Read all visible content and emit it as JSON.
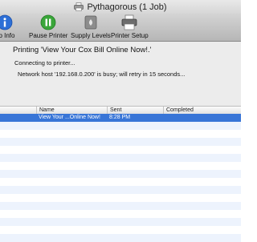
{
  "window": {
    "title": "Pythagorous (1 Job)"
  },
  "toolbar": {
    "items": [
      {
        "label": "ob Info",
        "icon": "info-icon"
      },
      {
        "label": "Pause Printer",
        "icon": "pause-icon"
      },
      {
        "label": "Supply Levels",
        "icon": "supply-levels-icon"
      },
      {
        "label": "Printer Setup",
        "icon": "printer-setup-icon"
      }
    ]
  },
  "status": {
    "title": "Printing 'View Your Cox Bill Online Now!.'",
    "sub": "Connecting to printer...",
    "message": "Network host '192.168.0.200' is busy; will retry in 15 seconds..."
  },
  "table": {
    "columns": [
      "Name",
      "Sent",
      "Completed"
    ],
    "rows": [
      {
        "name": "View Your ...Online Now!",
        "sent": "8:28 PM",
        "completed": ""
      }
    ]
  },
  "colors": {
    "selection": "#3875d7",
    "row_alt": "#edf3fd",
    "info_blue": "#2d6fd6",
    "pause_green": "#3aa63a"
  }
}
